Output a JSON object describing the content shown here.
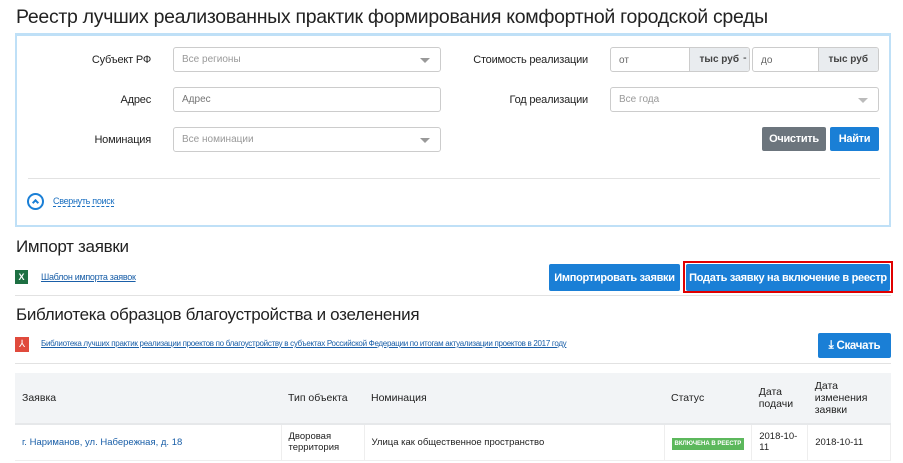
{
  "page_title": "Реестр лучших реализованных практик формирования комфортной городской среды",
  "filters": {
    "subject_label": "Субъект РФ",
    "subject_value": "Все регионы",
    "address_label": "Адрес",
    "address_placeholder": "Адрес",
    "nomination_label": "Номинация",
    "nomination_value": "Все номинации",
    "cost_label": "Стоимость реализации",
    "cost_from_placeholder": "от",
    "cost_to_placeholder": "до",
    "cost_unit": "тыс руб",
    "cost_dash": "-",
    "year_label": "Год реализации",
    "year_value": "Все года",
    "clear_label": "Очистить",
    "search_label": "Найти",
    "collapse_label": "Свернуть поиск"
  },
  "import": {
    "heading": "Импорт заявки",
    "template_link": "Шаблон импорта заявок",
    "import_button": "Импортировать заявки",
    "submit_button": "Подать заявку на включение в реестр"
  },
  "library": {
    "heading": "Библиотека образцов благоустройства и озеленения",
    "pdf_link": "Библиотека лучших практик реализации проектов по благоустройству в субъектах Российской Федерации по итогам актуализации проектов в 2017 году",
    "download_button": "Скачать"
  },
  "table": {
    "headers": [
      "Заявка",
      "Тип объекта",
      "Номинация",
      "Статус",
      "Дата подачи",
      "Дата изменения заявки"
    ],
    "rows": [
      {
        "request": "г. Нариманов, ул. Набережная, д. 18",
        "type": "Дворовая территория",
        "nomination": "Улица как общественное пространство",
        "status": "ВКЛЮЧЕНА В РЕЕСТР",
        "submitted": "2018-10-11",
        "changed": "2018-10-11"
      }
    ]
  },
  "colors": {
    "accent": "#1a7fd6",
    "highlight": "#e00000",
    "status_green": "#5cb85c"
  }
}
